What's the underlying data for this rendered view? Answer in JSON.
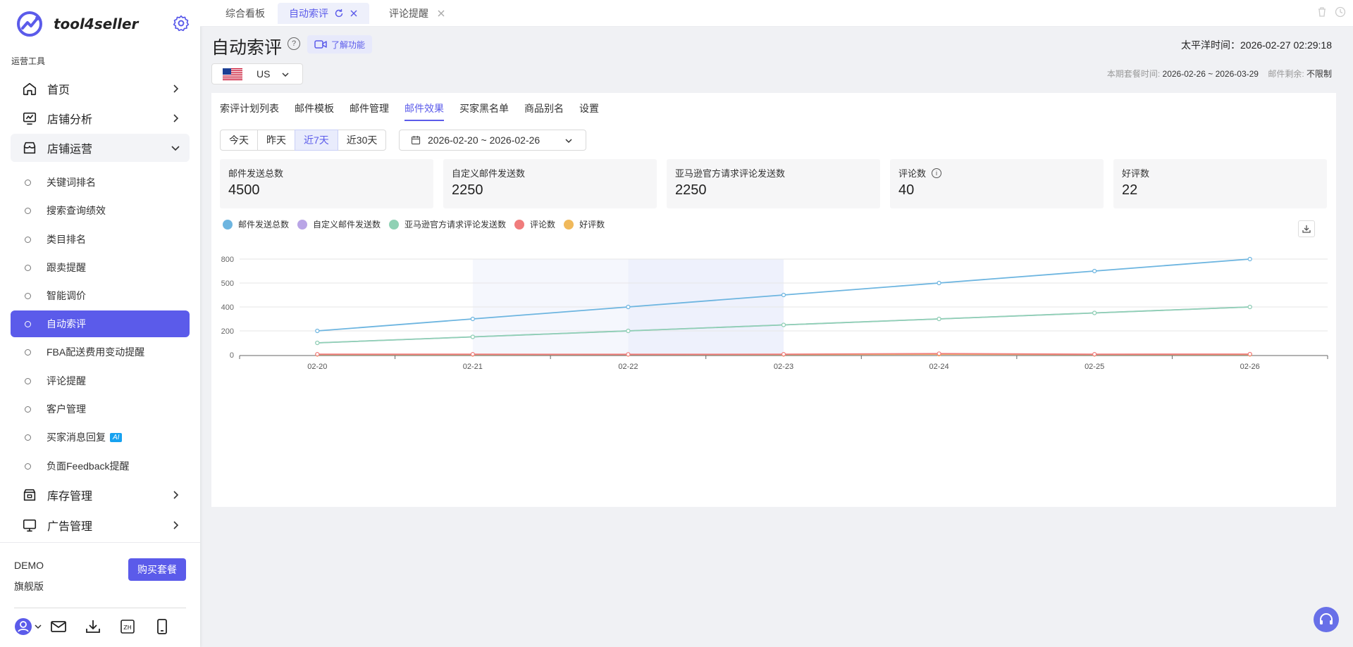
{
  "app": {
    "name": "tool4seller"
  },
  "sidebar": {
    "section_label": "运营工具",
    "top_items": [
      {
        "label": "首页",
        "icon": "home-icon"
      },
      {
        "label": "店铺分析",
        "icon": "analytics-icon"
      },
      {
        "label": "店铺运营",
        "icon": "store-icon"
      },
      {
        "label": "库存管理",
        "icon": "inventory-icon"
      },
      {
        "label": "广告管理",
        "icon": "monitor-icon"
      }
    ],
    "sub_items": [
      {
        "label": "关键词排名"
      },
      {
        "label": "搜索查询绩效"
      },
      {
        "label": "类目排名"
      },
      {
        "label": "跟卖提醒"
      },
      {
        "label": "智能调价"
      },
      {
        "label": "自动索评"
      },
      {
        "label": "FBA配送费用变动提醒"
      },
      {
        "label": "评论提醒"
      },
      {
        "label": "客户管理"
      },
      {
        "label": "买家消息回复",
        "badge": "AI"
      },
      {
        "label": "负面Feedback提醒"
      }
    ],
    "footer": {
      "plan_name": "DEMO",
      "plan_tier": "旗舰版",
      "buy_label": "购买套餐",
      "lang_label": "ZH"
    }
  },
  "tabs": [
    {
      "label": "综合看板"
    },
    {
      "label": "自动索评"
    },
    {
      "label": "评论提醒"
    }
  ],
  "header": {
    "title": "自动索评",
    "help_glyph": "?",
    "learn_label": "了解功能",
    "pacific_time": "太平洋时间：2026-02-27 02:29:18",
    "market": "US",
    "period_label": "本期套餐时间: ",
    "period_value": "2026-02-26 ~ 2026-03-29",
    "email_remaining_label": "邮件剩余: ",
    "email_remaining_value": "不限制"
  },
  "subtabs": [
    {
      "label": "索评计划列表"
    },
    {
      "label": "邮件模板"
    },
    {
      "label": "邮件管理"
    },
    {
      "label": "邮件效果"
    },
    {
      "label": "买家黑名单"
    },
    {
      "label": "商品别名"
    },
    {
      "label": "设置"
    }
  ],
  "range_buttons": [
    {
      "label": "今天"
    },
    {
      "label": "昨天"
    },
    {
      "label": "近7天"
    },
    {
      "label": "近30天"
    }
  ],
  "date_range": "2026-02-20 ~ 2026-02-26",
  "stats": [
    {
      "label": "邮件发送总数",
      "value": "4500"
    },
    {
      "label": "自定义邮件发送数",
      "value": "2250"
    },
    {
      "label": "亚马逊官方请求评论发送数",
      "value": "2250"
    },
    {
      "label": "评论数",
      "value": "40",
      "info": "i"
    },
    {
      "label": "好评数",
      "value": "22"
    }
  ],
  "chart_data": {
    "type": "line",
    "x": [
      "02-20",
      "02-21",
      "02-22",
      "02-23",
      "02-24",
      "02-25",
      "02-26"
    ],
    "ytick_labels": [
      "0",
      "200",
      "400",
      "500",
      "800"
    ],
    "ylim": [
      0,
      800
    ],
    "grid": true,
    "legend_position": "top-left",
    "highlight_bands": [
      [
        "02-21",
        "02-22"
      ],
      [
        "02-22",
        "02-23"
      ]
    ],
    "series": [
      {
        "name": "邮件发送总数",
        "color": "#6db5e0",
        "values": [
          200,
          300,
          400,
          500,
          600,
          700,
          800
        ]
      },
      {
        "name": "自定义邮件发送数",
        "color": "#b9a5e6",
        "values": [
          100,
          150,
          200,
          250,
          300,
          350,
          400
        ]
      },
      {
        "name": "亚马逊官方请求评论发送数",
        "color": "#8fd1b4",
        "values": [
          100,
          150,
          200,
          250,
          300,
          350,
          400
        ]
      },
      {
        "name": "评论数",
        "color": "#f07c7c",
        "values": [
          5,
          5,
          4,
          5,
          10,
          5,
          6
        ]
      },
      {
        "name": "好评数",
        "color": "#f0b95b",
        "values": [
          3,
          3,
          3,
          3,
          5,
          3,
          3
        ]
      }
    ]
  }
}
